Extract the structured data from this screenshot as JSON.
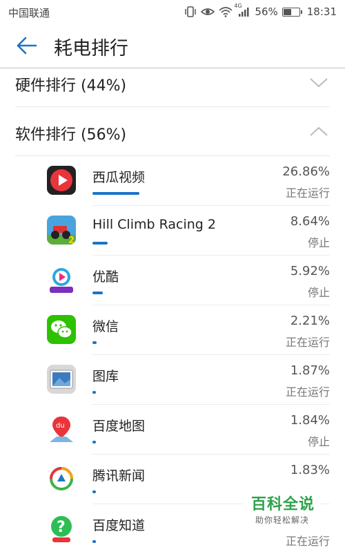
{
  "status_bar": {
    "carrier": "中国联通",
    "network": "4G",
    "battery_percent": "56%",
    "battery_level": 0.56,
    "time": "18:31"
  },
  "app_bar": {
    "title": "耗电排行",
    "back_icon": "arrow-left-icon"
  },
  "sections": {
    "hardware": {
      "label": "硬件排行 (44%)",
      "expanded": false
    },
    "software": {
      "label": "软件排行 (56%)",
      "expanded": true
    }
  },
  "apps": [
    {
      "name": "西瓜视频",
      "percent": "26.86%",
      "usage": 26.86,
      "status": "正在运行",
      "icon": "xigua-video-icon"
    },
    {
      "name": "Hill Climb Racing 2",
      "percent": "8.64%",
      "usage": 8.64,
      "status": "停止",
      "icon": "hill-climb-racing-icon"
    },
    {
      "name": "优酷",
      "percent": "5.92%",
      "usage": 5.92,
      "status": "停止",
      "icon": "youku-icon"
    },
    {
      "name": "微信",
      "percent": "2.21%",
      "usage": 2.21,
      "status": "正在运行",
      "icon": "wechat-icon"
    },
    {
      "name": "图库",
      "percent": "1.87%",
      "usage": 1.87,
      "status": "正在运行",
      "icon": "gallery-icon"
    },
    {
      "name": "百度地图",
      "percent": "1.84%",
      "usage": 1.84,
      "status": "停止",
      "icon": "baidu-map-icon"
    },
    {
      "name": "腾讯新闻",
      "percent": "1.83%",
      "usage": 1.83,
      "status": "",
      "icon": "tencent-news-icon"
    },
    {
      "name": "百度知道",
      "percent": "",
      "usage": 1.8,
      "status": "正在运行",
      "icon": "baidu-zhidao-icon"
    }
  ],
  "watermark": {
    "title": "百科全说",
    "subtitle": "助你轻松解决"
  },
  "colors": {
    "accent": "#1a73c8",
    "wechat": "#2dc100",
    "xigua": "#e8343a"
  }
}
